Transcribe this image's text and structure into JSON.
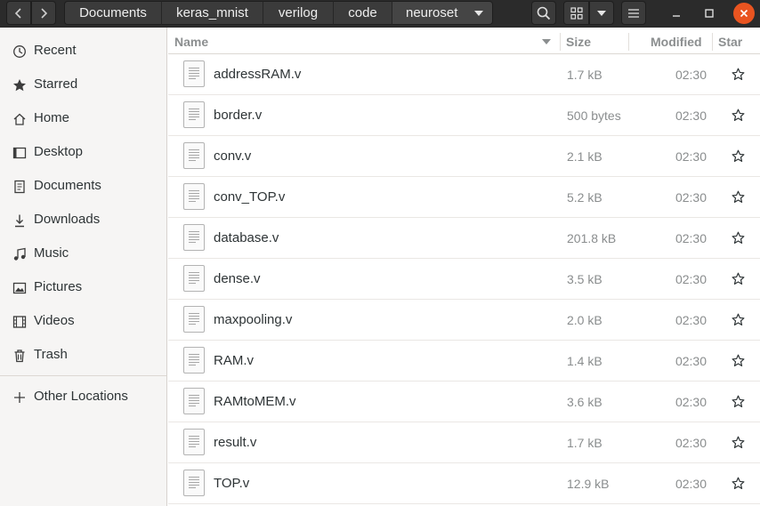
{
  "header": {
    "breadcrumbs": [
      "Documents",
      "keras_mnist",
      "verilog",
      "code",
      "neuroset"
    ],
    "icons": {
      "back": "chevron-left-icon",
      "forward": "chevron-right-icon",
      "crumb_menu": "chevron-down-icon",
      "search": "search-icon",
      "view": "grid-icon",
      "view_menu": "chevron-down-icon",
      "menu": "hamburger-icon",
      "minimize": "minimize-icon",
      "maximize": "maximize-icon",
      "close": "close-icon"
    },
    "close_color": "#e95420"
  },
  "sidebar": {
    "items": [
      {
        "label": "Recent",
        "icon": "clock-icon"
      },
      {
        "label": "Starred",
        "icon": "star-icon"
      },
      {
        "label": "Home",
        "icon": "home-icon"
      },
      {
        "label": "Desktop",
        "icon": "desktop-icon"
      },
      {
        "label": "Documents",
        "icon": "document-icon"
      },
      {
        "label": "Downloads",
        "icon": "download-icon"
      },
      {
        "label": "Music",
        "icon": "music-icon"
      },
      {
        "label": "Pictures",
        "icon": "picture-icon"
      },
      {
        "label": "Videos",
        "icon": "video-icon"
      },
      {
        "label": "Trash",
        "icon": "trash-icon"
      }
    ],
    "other_locations": {
      "label": "Other Locations",
      "icon": "plus-icon"
    }
  },
  "columns": {
    "name": "Name",
    "size": "Size",
    "modified": "Modified",
    "star": "Star"
  },
  "files": [
    {
      "name": "addressRAM.v",
      "size": "1.7 kB",
      "modified": "02:30"
    },
    {
      "name": "border.v",
      "size": "500 bytes",
      "modified": "02:30"
    },
    {
      "name": "conv.v",
      "size": "2.1 kB",
      "modified": "02:30"
    },
    {
      "name": "conv_TOP.v",
      "size": "5.2 kB",
      "modified": "02:30"
    },
    {
      "name": "database.v",
      "size": "201.8 kB",
      "modified": "02:30"
    },
    {
      "name": "dense.v",
      "size": "3.5 kB",
      "modified": "02:30"
    },
    {
      "name": "maxpooling.v",
      "size": "2.0 kB",
      "modified": "02:30"
    },
    {
      "name": "RAM.v",
      "size": "1.4 kB",
      "modified": "02:30"
    },
    {
      "name": "RAMtoMEM.v",
      "size": "3.6 kB",
      "modified": "02:30"
    },
    {
      "name": "result.v",
      "size": "1.7 kB",
      "modified": "02:30"
    },
    {
      "name": "TOP.v",
      "size": "12.9 kB",
      "modified": "02:30"
    }
  ]
}
